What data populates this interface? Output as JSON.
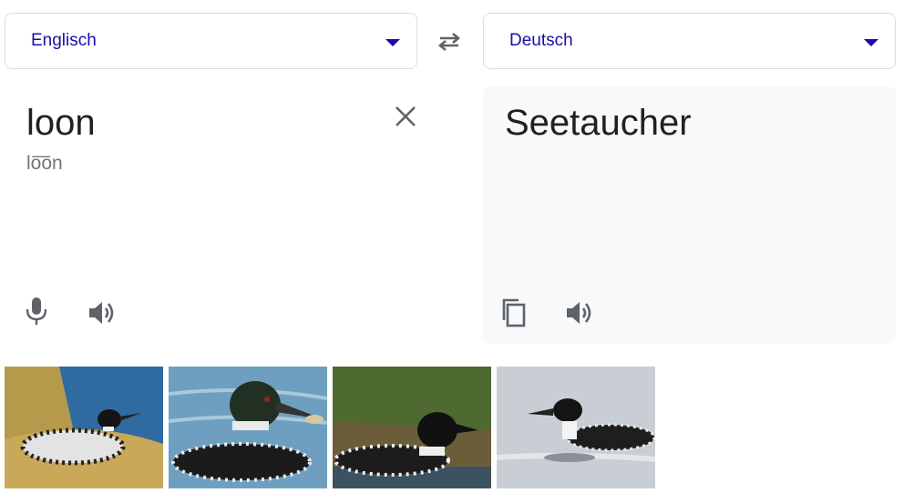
{
  "source_language": {
    "label": "Englisch"
  },
  "target_language": {
    "label": "Deutsch"
  },
  "source": {
    "text": "loon",
    "phonetic": "lo͞on"
  },
  "target": {
    "text": "Seetaucher"
  },
  "icons": {
    "swap": "swap-arrows-icon",
    "clear": "close-icon",
    "microphone": "microphone-icon",
    "speaker": "speaker-icon",
    "copy": "copy-icon"
  },
  "colors": {
    "language_text": "#1a0dab",
    "icon": "#5f6368",
    "target_panel_bg": "#f8f9fa",
    "border": "#dadce0"
  },
  "images": [
    {
      "subject": "loon-on-nest"
    },
    {
      "subject": "loon-with-fish"
    },
    {
      "subject": "loon-swimming"
    },
    {
      "subject": "loon-on-water"
    }
  ]
}
